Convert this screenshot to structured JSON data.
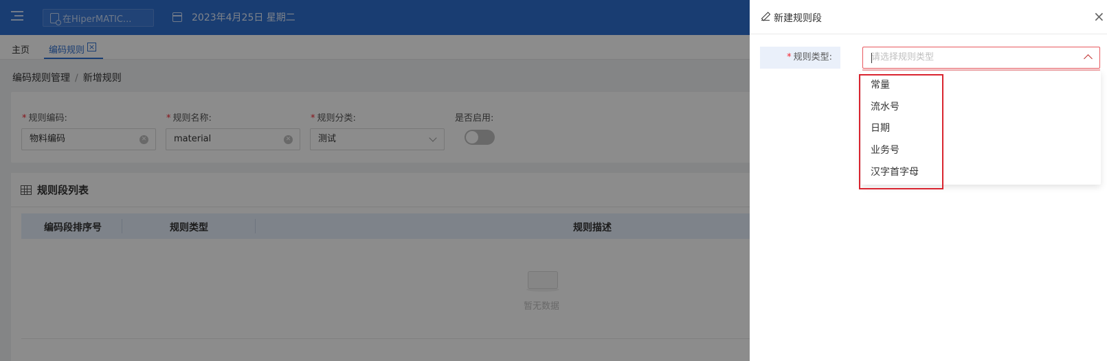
{
  "topbar": {
    "search_placeholder": "在HiperMATIC...",
    "date": "2023年4月25日 星期二"
  },
  "tabs": [
    {
      "label": "主页"
    },
    {
      "label": "编码规则",
      "close": "×"
    }
  ],
  "breadcrumb": {
    "parent": "编码规则管理",
    "separator": "/",
    "current": "新增规则"
  },
  "form": {
    "rule_code": {
      "label": "规则编码:",
      "value": "物料编码"
    },
    "rule_name": {
      "label": "规则名称:",
      "value": "material"
    },
    "rule_category": {
      "label": "规则分类:",
      "value": "测试"
    },
    "enabled": {
      "label": "是否启用:",
      "value": false
    },
    "required_mark": "*"
  },
  "segment_list": {
    "title": "规则段列表",
    "columns": [
      "编码段排序号",
      "规则类型",
      "规则描述"
    ],
    "empty_text": "暂无数据"
  },
  "drawer": {
    "title": "新建规则段",
    "close": "×",
    "rule_type_label": "规则类型:",
    "rule_type_placeholder": "请选择规则类型",
    "options": [
      "常量",
      "流水号",
      "日期",
      "业务号",
      "汉字首字母"
    ]
  },
  "colors": {
    "primary": "#2f6fd0",
    "error": "#d9232e",
    "overlay": "rgba(0,0,0,0.45)"
  }
}
